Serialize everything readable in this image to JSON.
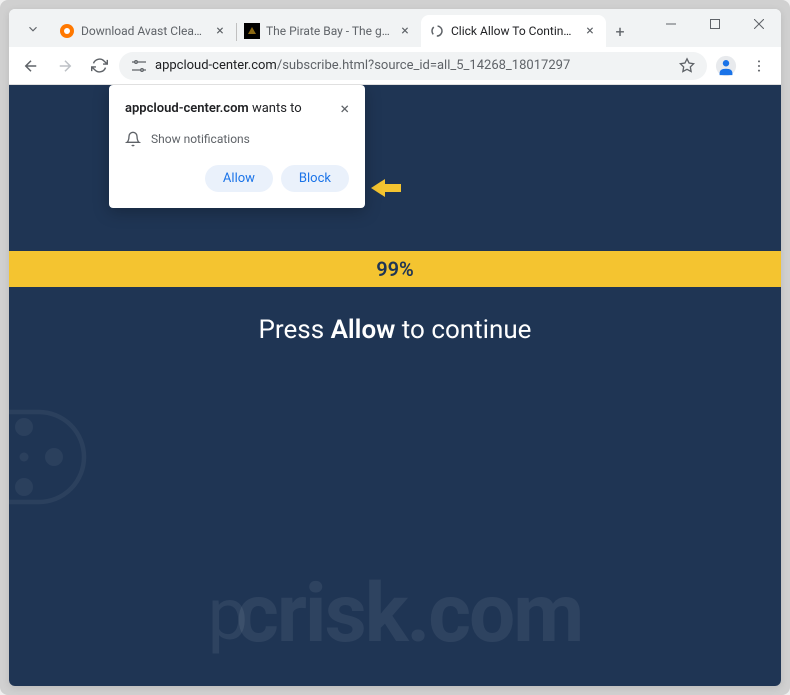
{
  "window": {
    "tabs": [
      {
        "title": "Download Avast Cleanup & Bo...",
        "favicon": "avast"
      },
      {
        "title": "The Pirate Bay - The galaxy's m...",
        "favicon": "tpb"
      },
      {
        "title": "Click Allow To Continue -",
        "favicon": "spinner"
      }
    ],
    "active_tab_index": 2
  },
  "address": {
    "domain": "appcloud-center.com",
    "path": "/subscribe.html?source_id=all_5_14268_18017297"
  },
  "notification": {
    "origin": "appcloud-center.com",
    "wants_to": "wants to",
    "body": "Show notifications",
    "allow_label": "Allow",
    "block_label": "Block"
  },
  "page": {
    "progress_text": "99%",
    "cta_prefix": "Press ",
    "cta_bold": "Allow",
    "cta_suffix": " to continue"
  },
  "watermark": {
    "p": "p",
    "text": "crisk.com"
  }
}
